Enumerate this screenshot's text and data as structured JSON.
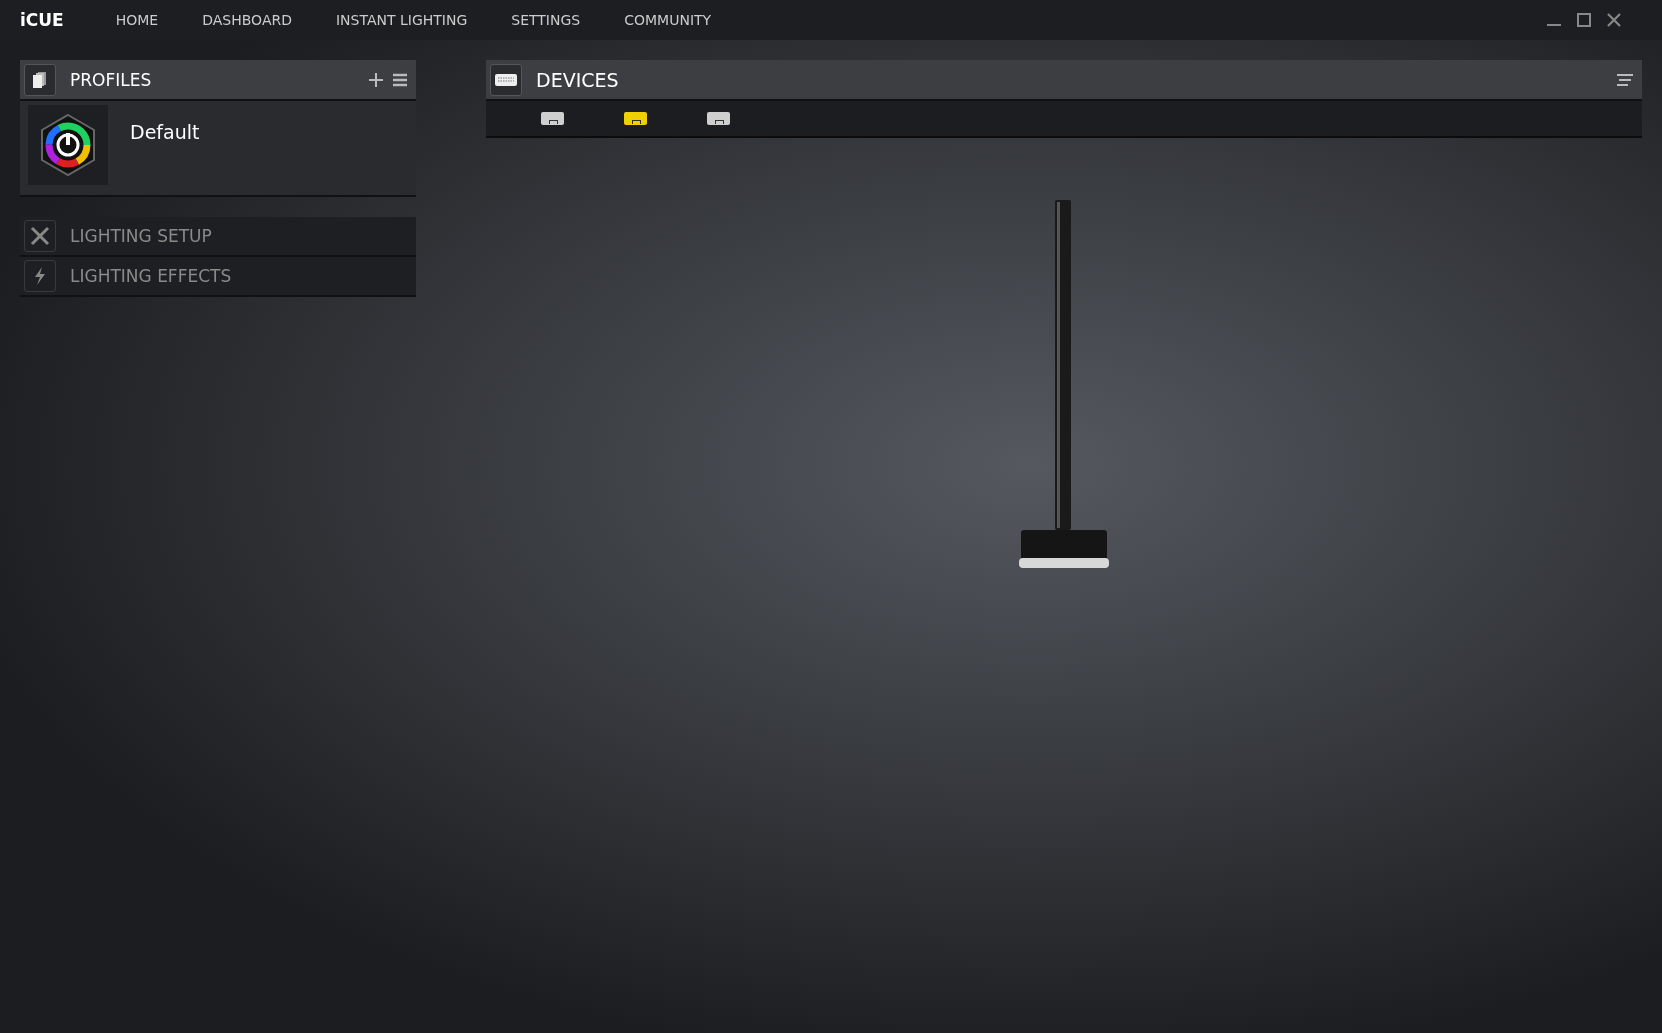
{
  "app": {
    "logo": "iCUE"
  },
  "nav": [
    {
      "label": "HOME"
    },
    {
      "label": "DASHBOARD"
    },
    {
      "label": "INSTANT LIGHTING"
    },
    {
      "label": "SETTINGS"
    },
    {
      "label": "COMMUNITY"
    }
  ],
  "profiles": {
    "title": "PROFILES",
    "items": [
      {
        "name": "Default"
      }
    ]
  },
  "sections": [
    {
      "label": "LIGHTING SETUP",
      "kind": "setup"
    },
    {
      "label": "LIGHTING EFFECTS",
      "kind": "effects"
    }
  ],
  "devices": {
    "title": "DEVICES",
    "tabs": [
      {
        "selected": false
      },
      {
        "selected": true
      },
      {
        "selected": false
      }
    ]
  }
}
